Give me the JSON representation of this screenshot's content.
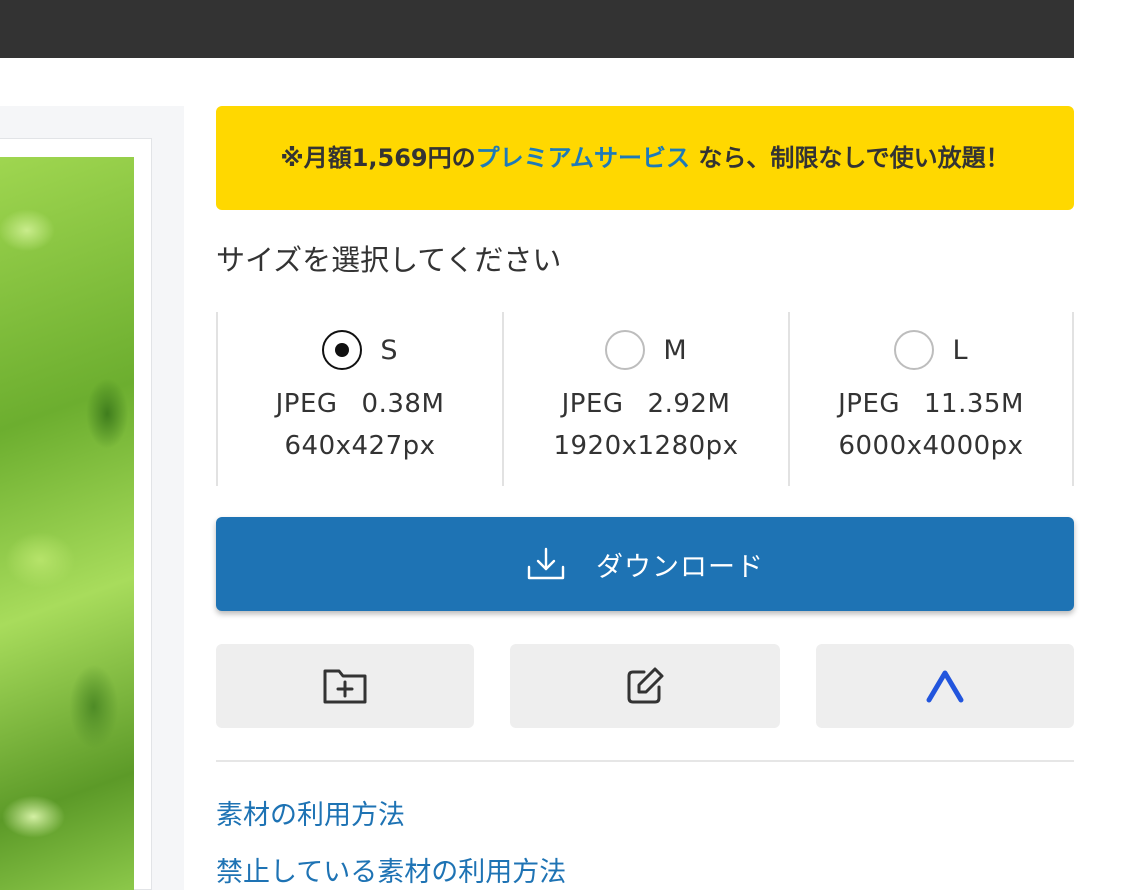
{
  "notice": {
    "prefix": "※月額1,569円の",
    "link": "プレミアムサービス",
    "suffix": " なら、制限なしで使い放題！"
  },
  "size_heading": "サイズを選択してください",
  "sizes": [
    {
      "label": "S",
      "format": "JPEG",
      "filesize": "0.38M",
      "dimensions": "640x427px",
      "selected": true
    },
    {
      "label": "M",
      "format": "JPEG",
      "filesize": "2.92M",
      "dimensions": "1920x1280px",
      "selected": false
    },
    {
      "label": "L",
      "format": "JPEG",
      "filesize": "11.35M",
      "dimensions": "6000x4000px",
      "selected": false
    }
  ],
  "download": {
    "label": "ダウンロード",
    "icon": "download-icon"
  },
  "actions": [
    {
      "name": "add-to-folder",
      "icon": "folder-plus-icon"
    },
    {
      "name": "edit",
      "icon": "edit-icon"
    },
    {
      "name": "scroll-top",
      "icon": "chevron-up-icon"
    }
  ],
  "links": [
    "素材の利用方法",
    "禁止している素材の利用方法"
  ],
  "colors": {
    "topbar": "#333333",
    "notice_bg": "#ffd800",
    "accent": "#1e73b4",
    "link": "#1e7ab8",
    "chevron": "#2255dd"
  }
}
